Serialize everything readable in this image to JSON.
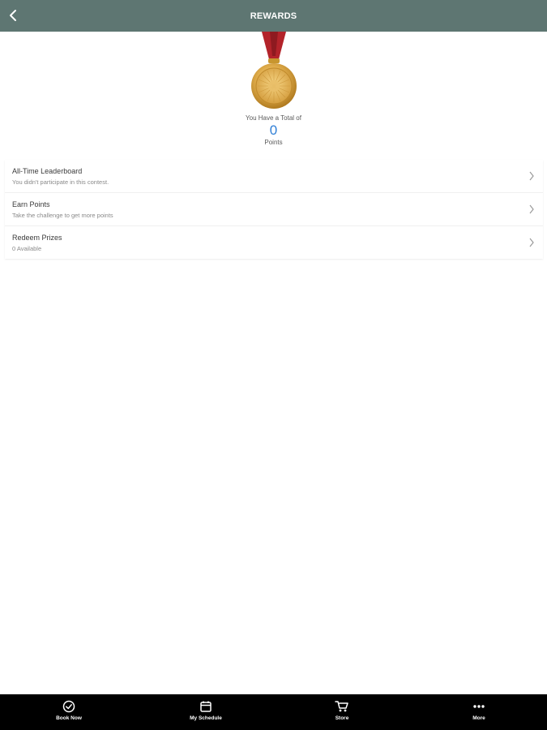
{
  "header": {
    "title": "REWARDS",
    "back_icon": "chevron-left-icon"
  },
  "medal": {
    "icon": "medal-icon",
    "ribbon_color": "#b3232a",
    "gold_color": "#d9a441"
  },
  "points": {
    "caption": "You Have a Total of",
    "value": "0",
    "unit": "Points",
    "value_color": "#2f7fd6"
  },
  "menu": {
    "items": [
      {
        "title": "All-Time Leaderboard",
        "subtitle": "You didn't participate in this contest."
      },
      {
        "title": "Earn Points",
        "subtitle": "Take the challenge to get more points"
      },
      {
        "title": "Redeem Prizes",
        "subtitle": "0 Available"
      }
    ]
  },
  "tabbar": {
    "tabs": [
      {
        "label": "Book Now",
        "icon": "check-circle-icon"
      },
      {
        "label": "My Schedule",
        "icon": "calendar-icon"
      },
      {
        "label": "Store",
        "icon": "cart-icon"
      },
      {
        "label": "More",
        "icon": "more-dots-icon"
      }
    ]
  },
  "colors": {
    "header_bg": "#5e7672",
    "tabbar_bg": "#000000"
  }
}
